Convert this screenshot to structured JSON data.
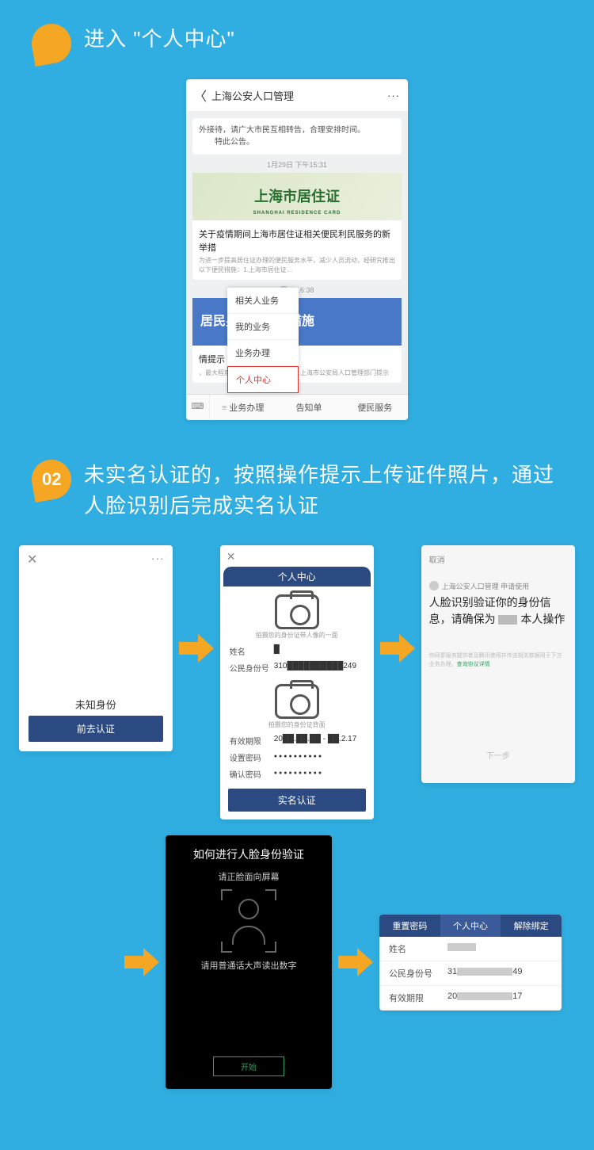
{
  "step1": {
    "title": "进入 \"个人中心\"",
    "phone": {
      "header_title": "上海公安人口管理",
      "notice_lines": [
        "外接待，请广大市民互相转告，合理安排时间。",
        "特此公告。"
      ],
      "time1": "1月29日 下午15:31",
      "banner1_text": "上海市居住证",
      "banner1_sub": "SHANGHAI RESIDENCE CARD",
      "card1_title": "关于疫情期间上海市居住证相关便民利民服务的新举措",
      "card1_desc": "为进一步提高居住证办理的便民服务水平，减少人员流动，经研究推出以下便民措施：1.上海市居住证…",
      "time2": "周一 16:38",
      "banner2_text": "居民身份证便民措施",
      "card2_title_tail": "情提示",
      "card2_desc": "，最大程度减少人员流动，保护……上海市公安局人口管理部门提示",
      "menu": [
        "相关人业务",
        "我的业务",
        "业务办理",
        "个人中心"
      ],
      "bottom_tabs": [
        "业务办理",
        "告知单",
        "便民服务"
      ]
    }
  },
  "step2": {
    "badge": "02",
    "title": "未实名认证的，按照操作提示上传证件照片，通过人脸识别后完成实名认证",
    "scrA": {
      "text": "未知身份",
      "button": "前去认证"
    },
    "scrB": {
      "header": "个人中心",
      "cap_front": "拍摄您的身份证带人像的一面",
      "cap_back": "拍摄您的身份证背面",
      "rows": {
        "name_k": "姓名",
        "name_v": "█",
        "id_k": "公民身份号",
        "id_v": "310██████████249",
        "exp_k": "有效期限",
        "exp_v": "20██.██.██ - ██.2.17",
        "pw1_k": "设置密码",
        "pw2_k": "确认密码"
      },
      "button": "实名认证"
    },
    "scrC": {
      "back": "取消",
      "app": "上海公安人口管理 申请使用",
      "msg_pre": "人脸识别验证你的身份信息，请确保为 ",
      "msg_post": " 本人操作",
      "fine_pre": "你同意服务提供者及腾讯使用并传送相关数据用于下方业务办理。",
      "fine_link": "查询协议详情",
      "next": "下一步"
    },
    "scrD": {
      "title": "如何进行人脸身份验证",
      "line1": "请正脸面向屏幕",
      "line2": "请用普通话大声读出数字",
      "start": "开始"
    },
    "scrE": {
      "tabs": [
        "重置密码",
        "个人中心",
        "解除绑定"
      ],
      "rows": {
        "name_k": "姓名",
        "id_k": "公民身份号",
        "id_pre": "31",
        "id_suf": "49",
        "exp_k": "有效期限",
        "exp_pre": "20",
        "exp_suf": "17"
      }
    }
  }
}
